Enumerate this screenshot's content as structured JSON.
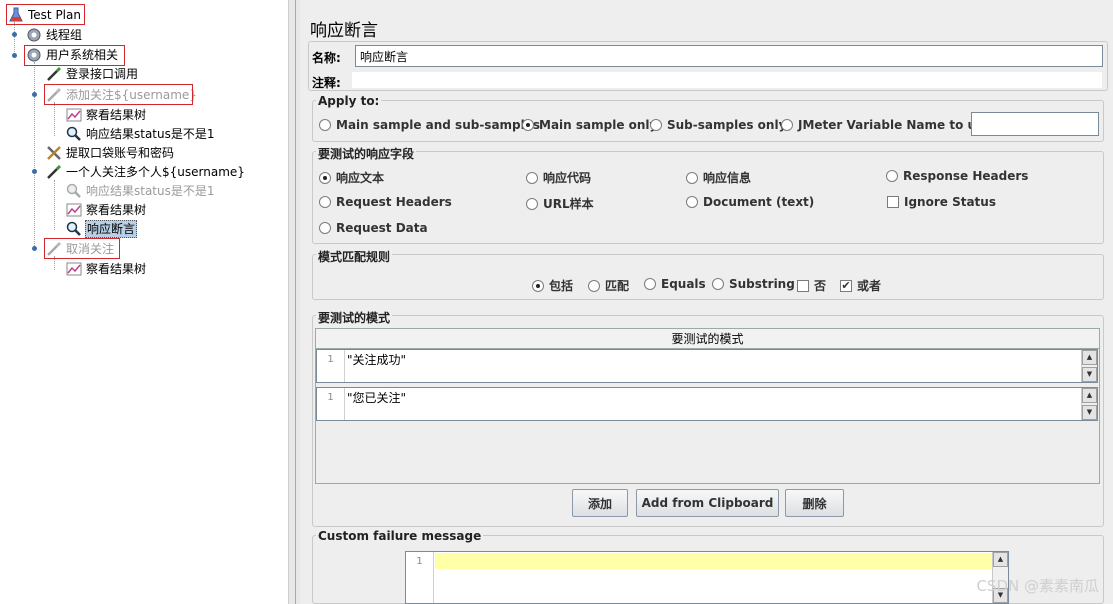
{
  "tree": {
    "items": [
      {
        "label": "Test Plan"
      },
      {
        "label": "线程组"
      },
      {
        "label": "用户系统相关"
      },
      {
        "label": "登录接口调用"
      },
      {
        "label": "添加关注${username}"
      },
      {
        "label": "察看结果树"
      },
      {
        "label": "响应结果status是不是1"
      },
      {
        "label": "提取口袋账号和密码"
      },
      {
        "label": "一个人关注多个人${username}"
      },
      {
        "label": "响应结果status是不是1"
      },
      {
        "label": "察看结果树"
      },
      {
        "label": "响应断言"
      },
      {
        "label": "取消关注"
      },
      {
        "label": "察看结果树"
      }
    ]
  },
  "panel": {
    "title": "响应断言",
    "name_label": "名称:",
    "name_value": "响应断言",
    "comment_label": "注释:",
    "apply_to": {
      "title": "Apply to:",
      "options": [
        "Main sample and sub-samples",
        "Main sample only",
        "Sub-samples only",
        "JMeter Variable Name to use"
      ],
      "selected": "Main sample only"
    },
    "response_field": {
      "title": "要测试的响应字段",
      "options": [
        "响应文本",
        "响应代码",
        "响应信息",
        "Response Headers",
        "Request Headers",
        "URL样本",
        "Document (text)",
        "Request Data"
      ],
      "selected": "响应文本",
      "ignore_status": "Ignore Status"
    },
    "pattern_rules": {
      "title": "模式匹配规则",
      "options": [
        "包括",
        "匹配",
        "Equals",
        "Substring"
      ],
      "selected": "包括",
      "not_label": "否",
      "or_label": "或者"
    },
    "patterns": {
      "title": "要测试的模式",
      "column_header": "要测试的模式",
      "rows": [
        {
          "line": "1",
          "text": "\"关注成功\""
        },
        {
          "line": "1",
          "text": "\"您已关注\""
        }
      ]
    },
    "buttons": {
      "add": "添加",
      "add_clipboard": "Add from Clipboard",
      "delete": "删除"
    },
    "custom_failure": {
      "title": "Custom failure message",
      "line": "1"
    }
  },
  "watermark": "CSDN @素素南瓜",
  "colors": {
    "selection": "#b8cfe5",
    "highlight_box": "#d2272d",
    "editor_line": "#ffffa8"
  }
}
